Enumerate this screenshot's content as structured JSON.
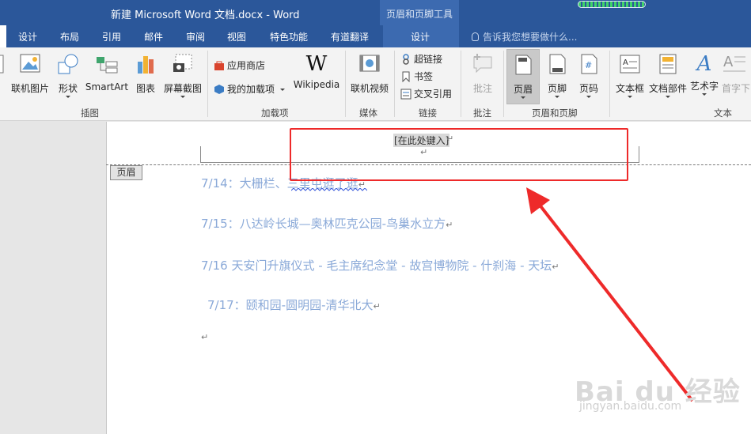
{
  "window": {
    "title": "新建 Microsoft Word 文档.docx - Word",
    "context_tools_label": "页眉和页脚工具"
  },
  "tabs": [
    "设计",
    "布局",
    "引用",
    "邮件",
    "审阅",
    "视图",
    "特色功能",
    "有道翻译"
  ],
  "context_tab": "设计",
  "tell_me_placeholder": "告诉我您想要做什么...",
  "ribbon": {
    "illustrations": {
      "label": "插图",
      "buttons": [
        "联机图片",
        "形状",
        "SmartArt",
        "图表",
        "屏幕截图"
      ]
    },
    "addins": {
      "label": "加载项",
      "store": "应用商店",
      "my_addins": "我的加载项",
      "wikipedia": "Wikipedia"
    },
    "media": {
      "label": "媒体",
      "online_video": "联机视频"
    },
    "links": {
      "label": "链接",
      "hyperlink": "超链接",
      "bookmark": "书签",
      "cross_ref": "交叉引用"
    },
    "comments": {
      "label": "批注",
      "comment": "批注"
    },
    "header_footer": {
      "label": "页眉和页脚",
      "header": "页眉",
      "footer": "页脚",
      "page_number": "页码"
    },
    "text": {
      "label": "文本",
      "textbox": "文本框",
      "quick_parts": "文档部件",
      "wordart": "艺术字",
      "dropcap": "首字下"
    }
  },
  "document": {
    "header_tag": "页眉",
    "header_placeholder": "[在此处键入]",
    "lines": [
      "7/14：大栅栏、三里屯逛了逛",
      "7/15：八达岭长城—奥林匹克公园-鸟巢水立方",
      "7/16 天安门升旗仪式 - 毛主席纪念堂 - 故宫博物院 - 什刹海 - 天坛",
      "7/17：颐和园-圆明园-清华北大"
    ],
    "paragraph_mark": "↵"
  },
  "watermark": {
    "brand": "Bai du 经验",
    "url": "jingyan.baidu.com"
  },
  "colors": {
    "title_bar": "#2b579a",
    "annotation": "#ee2a2a",
    "doc_text": "#8aa9d8"
  }
}
